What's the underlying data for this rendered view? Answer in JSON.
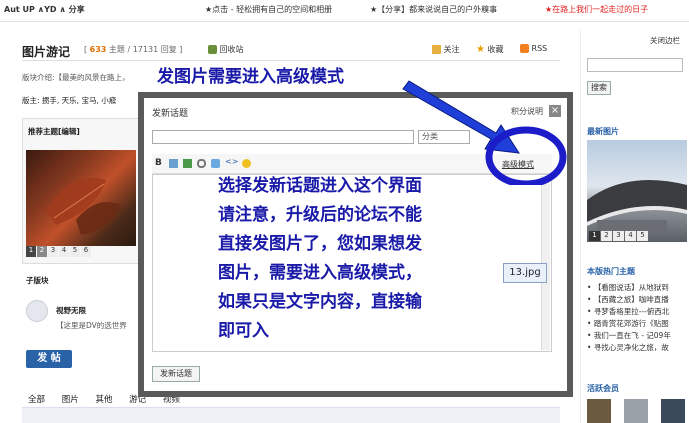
{
  "topbar": {
    "brand": "Aut UP ∧YD ∧ 分享",
    "link1": "★点击 - 轻松拥有自己的空间和相册",
    "link2": "★【分享】都来说说自己的户外糗事",
    "link3": "★在路上我们一起走过的日子",
    "link3_color": "#e02020"
  },
  "header": {
    "title": "图片游记",
    "topics": "633",
    "topics_label": "主题 /",
    "posts": "17131",
    "posts_label": "回复 ]",
    "favorites_label": "回收站",
    "follow_label": "关注",
    "collect_label": "收藏",
    "rss_label": "RSS",
    "close_sidebar": "关闭边栏"
  },
  "forum_info": {
    "intro": "版块介绍:【最美的风景在路上，",
    "moderators": "版主: 掼手, 天乐, 宝马, 小瘊"
  },
  "recommended": {
    "title": "推荐主题[编辑]",
    "pages": [
      "1",
      "2",
      "3",
      "4",
      "5",
      "6"
    ]
  },
  "sub_forum": {
    "title": "子版块",
    "name": "视野无限",
    "desc": "【这里是DV的选世界"
  },
  "post_button": "发 帖",
  "tabs": [
    "全部",
    "图片",
    "其他",
    "游记",
    "视频"
  ],
  "sidebar": {
    "search_button": "搜索",
    "latest_images": "最新图片",
    "latest_pages": [
      "1",
      "2",
      "3",
      "4",
      "5"
    ],
    "hot_title": "本版热门主题",
    "hot_items": [
      "【看图说话】从地狱到",
      "【西藏之旅】咖啡直播",
      "寻梦香格里拉---俯西北",
      "踏青赏花郊游行《贴图",
      "我们一直在飞 - 记09年",
      "寻找心灵净化之旅，故"
    ],
    "active_members": "活跃会员"
  },
  "modal": {
    "title": "发新话题",
    "help": "积分说明",
    "close": "×",
    "category_placeholder": "分类",
    "advanced_mode": "高级模式",
    "submit": "发新话题",
    "file_tag": "13.jpg"
  },
  "callouts": {
    "top": "发图片需要进入高级模式",
    "body": [
      "选择发新话题进入这个界面",
      "请注意，升级后的论坛不能",
      "直接发图片了，您如果想发",
      "图片，需要进入高级模式，",
      "如果只是文字内容，直接输",
      "即可入"
    ]
  },
  "colors": {
    "callout_blue": "#1a1aa8",
    "circle_blue": "#1c1cc8",
    "arrow_blue": "#1f3fd8",
    "post_button": "#2a62a8"
  }
}
